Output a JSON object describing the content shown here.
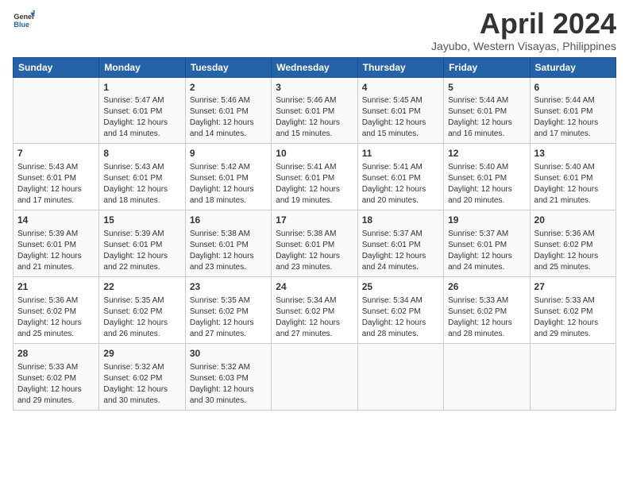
{
  "logo": {
    "line1": "General",
    "line2": "Blue"
  },
  "title": "April 2024",
  "subtitle": "Jayubo, Western Visayas, Philippines",
  "headers": [
    "Sunday",
    "Monday",
    "Tuesday",
    "Wednesday",
    "Thursday",
    "Friday",
    "Saturday"
  ],
  "weeks": [
    [
      {
        "day": "",
        "info": ""
      },
      {
        "day": "1",
        "info": "Sunrise: 5:47 AM\nSunset: 6:01 PM\nDaylight: 12 hours\nand 14 minutes."
      },
      {
        "day": "2",
        "info": "Sunrise: 5:46 AM\nSunset: 6:01 PM\nDaylight: 12 hours\nand 14 minutes."
      },
      {
        "day": "3",
        "info": "Sunrise: 5:46 AM\nSunset: 6:01 PM\nDaylight: 12 hours\nand 15 minutes."
      },
      {
        "day": "4",
        "info": "Sunrise: 5:45 AM\nSunset: 6:01 PM\nDaylight: 12 hours\nand 15 minutes."
      },
      {
        "day": "5",
        "info": "Sunrise: 5:44 AM\nSunset: 6:01 PM\nDaylight: 12 hours\nand 16 minutes."
      },
      {
        "day": "6",
        "info": "Sunrise: 5:44 AM\nSunset: 6:01 PM\nDaylight: 12 hours\nand 17 minutes."
      }
    ],
    [
      {
        "day": "7",
        "info": "Sunrise: 5:43 AM\nSunset: 6:01 PM\nDaylight: 12 hours\nand 17 minutes."
      },
      {
        "day": "8",
        "info": "Sunrise: 5:43 AM\nSunset: 6:01 PM\nDaylight: 12 hours\nand 18 minutes."
      },
      {
        "day": "9",
        "info": "Sunrise: 5:42 AM\nSunset: 6:01 PM\nDaylight: 12 hours\nand 18 minutes."
      },
      {
        "day": "10",
        "info": "Sunrise: 5:41 AM\nSunset: 6:01 PM\nDaylight: 12 hours\nand 19 minutes."
      },
      {
        "day": "11",
        "info": "Sunrise: 5:41 AM\nSunset: 6:01 PM\nDaylight: 12 hours\nand 20 minutes."
      },
      {
        "day": "12",
        "info": "Sunrise: 5:40 AM\nSunset: 6:01 PM\nDaylight: 12 hours\nand 20 minutes."
      },
      {
        "day": "13",
        "info": "Sunrise: 5:40 AM\nSunset: 6:01 PM\nDaylight: 12 hours\nand 21 minutes."
      }
    ],
    [
      {
        "day": "14",
        "info": "Sunrise: 5:39 AM\nSunset: 6:01 PM\nDaylight: 12 hours\nand 21 minutes."
      },
      {
        "day": "15",
        "info": "Sunrise: 5:39 AM\nSunset: 6:01 PM\nDaylight: 12 hours\nand 22 minutes."
      },
      {
        "day": "16",
        "info": "Sunrise: 5:38 AM\nSunset: 6:01 PM\nDaylight: 12 hours\nand 23 minutes."
      },
      {
        "day": "17",
        "info": "Sunrise: 5:38 AM\nSunset: 6:01 PM\nDaylight: 12 hours\nand 23 minutes."
      },
      {
        "day": "18",
        "info": "Sunrise: 5:37 AM\nSunset: 6:01 PM\nDaylight: 12 hours\nand 24 minutes."
      },
      {
        "day": "19",
        "info": "Sunrise: 5:37 AM\nSunset: 6:01 PM\nDaylight: 12 hours\nand 24 minutes."
      },
      {
        "day": "20",
        "info": "Sunrise: 5:36 AM\nSunset: 6:02 PM\nDaylight: 12 hours\nand 25 minutes."
      }
    ],
    [
      {
        "day": "21",
        "info": "Sunrise: 5:36 AM\nSunset: 6:02 PM\nDaylight: 12 hours\nand 25 minutes."
      },
      {
        "day": "22",
        "info": "Sunrise: 5:35 AM\nSunset: 6:02 PM\nDaylight: 12 hours\nand 26 minutes."
      },
      {
        "day": "23",
        "info": "Sunrise: 5:35 AM\nSunset: 6:02 PM\nDaylight: 12 hours\nand 27 minutes."
      },
      {
        "day": "24",
        "info": "Sunrise: 5:34 AM\nSunset: 6:02 PM\nDaylight: 12 hours\nand 27 minutes."
      },
      {
        "day": "25",
        "info": "Sunrise: 5:34 AM\nSunset: 6:02 PM\nDaylight: 12 hours\nand 28 minutes."
      },
      {
        "day": "26",
        "info": "Sunrise: 5:33 AM\nSunset: 6:02 PM\nDaylight: 12 hours\nand 28 minutes."
      },
      {
        "day": "27",
        "info": "Sunrise: 5:33 AM\nSunset: 6:02 PM\nDaylight: 12 hours\nand 29 minutes."
      }
    ],
    [
      {
        "day": "28",
        "info": "Sunrise: 5:33 AM\nSunset: 6:02 PM\nDaylight: 12 hours\nand 29 minutes."
      },
      {
        "day": "29",
        "info": "Sunrise: 5:32 AM\nSunset: 6:02 PM\nDaylight: 12 hours\nand 30 minutes."
      },
      {
        "day": "30",
        "info": "Sunrise: 5:32 AM\nSunset: 6:03 PM\nDaylight: 12 hours\nand 30 minutes."
      },
      {
        "day": "",
        "info": ""
      },
      {
        "day": "",
        "info": ""
      },
      {
        "day": "",
        "info": ""
      },
      {
        "day": "",
        "info": ""
      }
    ]
  ]
}
